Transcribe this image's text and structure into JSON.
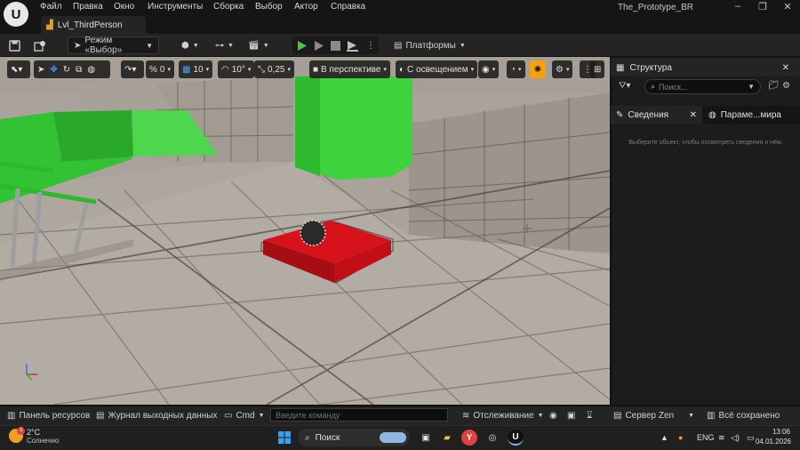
{
  "menu": [
    "Файл",
    "Правка",
    "Окно",
    "Инструменты",
    "Сборка",
    "Выбор",
    "Актор",
    "Справка"
  ],
  "project_title": "The_Prototype_BR",
  "level_tab": "Lvl_ThirdPerson",
  "toolbar": {
    "mode_label": "Режим «Выбор»",
    "platforms_label": "Платформы"
  },
  "viewport_toolbar": {
    "rotation_snap": "0",
    "grid_snap": "10",
    "angle_snap": "10°",
    "scale_snap": "0,25",
    "perspective_label": "В перспективе",
    "lighting_label": "С освещением"
  },
  "outliner": {
    "title": "Структура",
    "search_placeholder": "Поиск..."
  },
  "details": {
    "tab_details": "Сведения",
    "tab_world": "Параме...мира",
    "hint": "Выберите объект, чтобы посмотреть сведения о нём."
  },
  "status_bar": {
    "content_browser": "Панель ресурсов",
    "output_log": "Журнал выходных данных",
    "cmd_label": "Cmd",
    "cmd_placeholder": "Введите команду",
    "trace_label": "Отслеживание",
    "server_label": "Сервер Zen",
    "saved_label": "Всё сохранено"
  },
  "taskbar": {
    "weather_temp": "2°C",
    "weather_desc": "Солнечно",
    "weather_badge": "3",
    "search_label": "Поиск",
    "lang": "ENG",
    "time": "13:06",
    "date": "04.01.2026"
  },
  "colors": {
    "accent_green": "#3bb53b",
    "selected_red": "#cf1018",
    "snap_orange": "#f5a00d"
  }
}
